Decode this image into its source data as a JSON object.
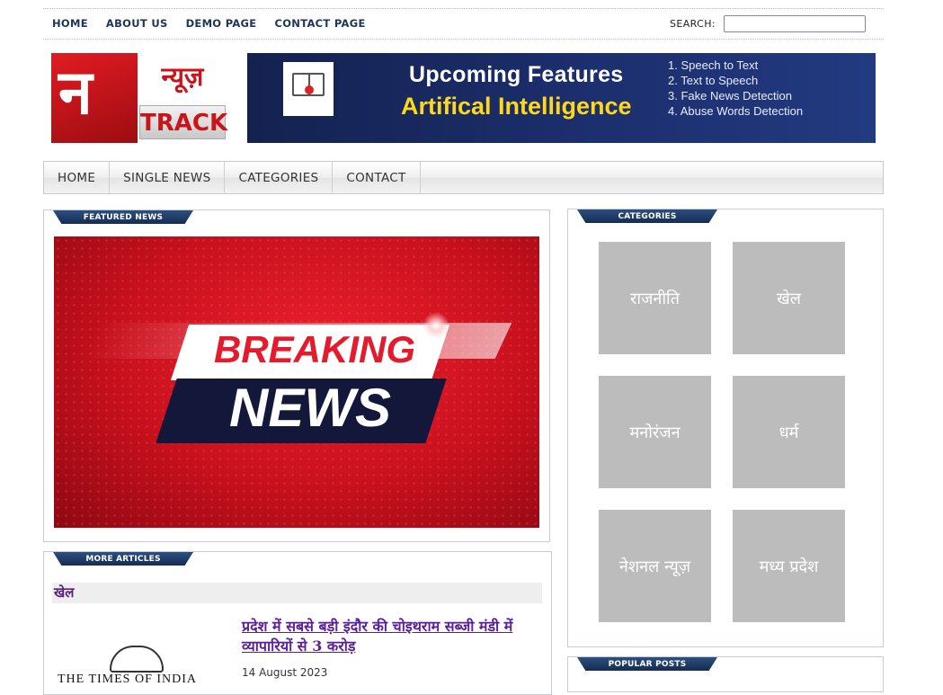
{
  "topnav": {
    "items": [
      "HOME",
      "ABOUT US",
      "DEMO PAGE",
      "CONTACT PAGE"
    ],
    "search_label": "SEARCH:"
  },
  "logo": {
    "glyph": "न",
    "hindi": "न्यूज़",
    "track": "TRACK"
  },
  "banner": {
    "line1": "Upcoming  Features",
    "line2": "Artifical Intelligence",
    "features": [
      "1. Speech to Text",
      "2. Text to Speech",
      "3. Fake News Detection",
      "4. Abuse Words Detection"
    ]
  },
  "mainnav": {
    "items": [
      "HOME",
      "SINGLE NEWS",
      "CATEGORIES",
      "CONTACT"
    ]
  },
  "featured": {
    "ribbon": "FEATURED NEWS",
    "image_line1": "BREAKING",
    "image_line2": "NEWS"
  },
  "more_articles": {
    "ribbon": "MORE ARTICLES",
    "category": "खेल",
    "thumb_text": "THE TIMES OF INDIA",
    "headline": "प्रदेश में सबसे बड़ी इंदौर की चोइथराम सब्जी मंडी में व्यापारियों से 3 करोड़",
    "date": "14 August 2023"
  },
  "categories": {
    "ribbon": "CATEGORIES",
    "tiles": [
      "राजनीति",
      "खेल",
      "मनोरंजन",
      "धर्म",
      "नेशनल न्यूज़",
      "मध्य प्रदेश"
    ]
  },
  "popular": {
    "ribbon": "POPULAR POSTS"
  },
  "colors": {
    "nav_text": "#1d3557",
    "ribbon": "#1f3b66",
    "tile": "#bdbcbd",
    "headline": "#5a1f9a",
    "banner_bg": "#1a2a63",
    "banner_accent": "#ffd81a"
  }
}
